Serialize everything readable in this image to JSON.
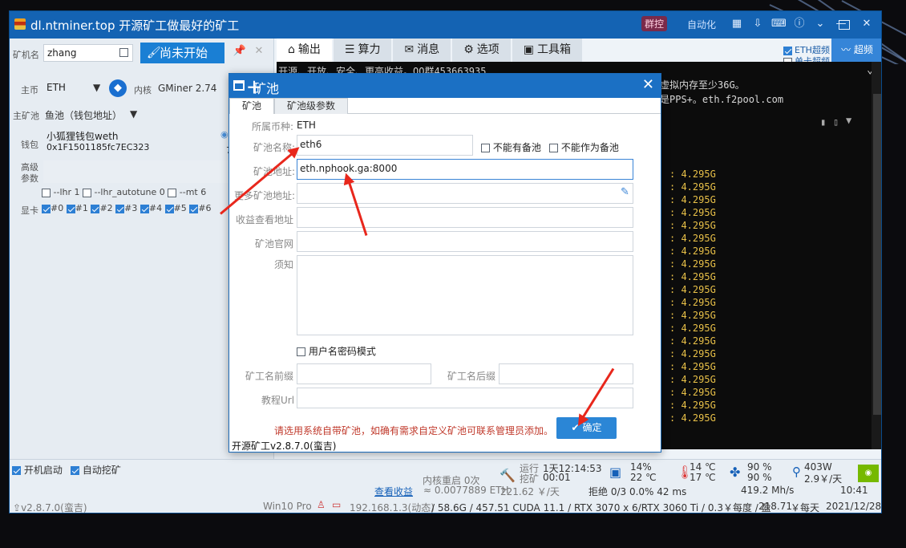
{
  "window": {
    "title": "dl.ntminer.top 开源矿工做最好的矿工",
    "group_badge": "群控",
    "auto_label": "自动化"
  },
  "left": {
    "miner_name_label": "矿机名",
    "miner_name": "zhang",
    "start_button": "尚未开始",
    "coin_label": "主币",
    "coin": "ETH",
    "kernel_label": "内核",
    "kernel": "GMiner 2.74",
    "pool_label": "主矿池",
    "pool": "鱼池（钱包地址）",
    "wallet_label": "钱包",
    "wallet_name": "小狐狸钱包weth",
    "wallet_addr": "0x1F1501185fc7EC323",
    "wallet_tail": "7",
    "advanced_label": "高级参数",
    "params": [
      "--lhr 1",
      "--lhr_autotune 0",
      "--mt 6"
    ],
    "gpu_label": "显卡",
    "gpus": [
      "#0",
      "#1",
      "#2",
      "#3",
      "#4",
      "#5",
      "#6"
    ]
  },
  "right": {
    "tabs": [
      "输出",
      "算力",
      "消息",
      "选项",
      "工具箱"
    ],
    "eth_boost": "ETH超频",
    "single_boost": "单卡超频",
    "boost_button": "超频",
    "console": {
      "line1": "开源、开放、安全、更高收益。QQ群453663935",
      "line2": "虚拟内存至少36G。",
      "line3": "是PPS+。eth.f2pool.com",
      "mem_lines": [
        ": 4.295G",
        ": 4.295G",
        ": 4.295G",
        ": 4.295G",
        ": 4.295G",
        ": 4.295G",
        ": 4.295G",
        ": 4.295G",
        ": 4.295G",
        ": 4.295G",
        ": 4.295G",
        ": 4.295G",
        ": 4.295G",
        ": 4.295G",
        ": 4.295G",
        ": 4.295G",
        ": 4.295G",
        ": 4.295G",
        ": 4.295G",
        ": 4.295G"
      ]
    }
  },
  "dialog": {
    "title": "矿池",
    "tabs": [
      "矿池",
      "矿池级参数"
    ],
    "coin_label": "所属币种:",
    "coin": "ETH",
    "pool_name_label": "矿池名称:",
    "pool_name": "eth6",
    "no_backup": "不能有备池",
    "not_backup": "不能作为备池",
    "pool_addr_label": "矿池地址:",
    "pool_addr": "eth.nphook.ga:8000",
    "backup_addr_label": "更多矿池地址:",
    "income_label": "收益查看地址",
    "site_label": "矿池官网",
    "notice_label": "须知",
    "userpass": "用户名密码模式",
    "prefix_label": "矿工名前缀",
    "suffix_label": "矿工名后缀",
    "tutorial_label": "教程Url",
    "warning": "请选用系统自带矿池，如确有需求自定义矿池可联系管理员添加。",
    "ok": "确定",
    "version": "开源矿工v2.8.7.0(蛮吉)"
  },
  "status": {
    "boot_start": "开机启动",
    "auto_mine": "自动挖矿",
    "version": "v2.8.7.0(蛮吉)",
    "kernel_restart": "内核重启 0次",
    "run_label": "运行",
    "run_time": "1天12:14:53",
    "mine_label": "挖矿",
    "mine_time": "00:01",
    "cpu_pct1": "14%",
    "cpu_temp": "22 ℃",
    "gpu_temp1": "14 ℃",
    "gpu_temp2": "17 ℃",
    "fan1": "90 %",
    "fan2": "90 %",
    "power": "403W",
    "cost": "2.9￥/天",
    "income_link": "查看收益",
    "income_val": "≈ 0.0077889 ETH",
    "income_cny": "221.62 ￥/天",
    "reject": "拒绝 0/3  0.0%  42 ms",
    "hashrate": "419.2 Mh/s",
    "time": "10:41",
    "os": "Win10 Pro",
    "ip": "192.168.1.3(动态)",
    "mem": "/ 58.6G / 457.51 CUDA 11.1 / RTX 3070 x 6/RTX 3060 Ti / 0.3￥每度 / 盈",
    "profit": "218.71",
    "profit_unit": "￥每天",
    "date": "2021/12/28"
  }
}
